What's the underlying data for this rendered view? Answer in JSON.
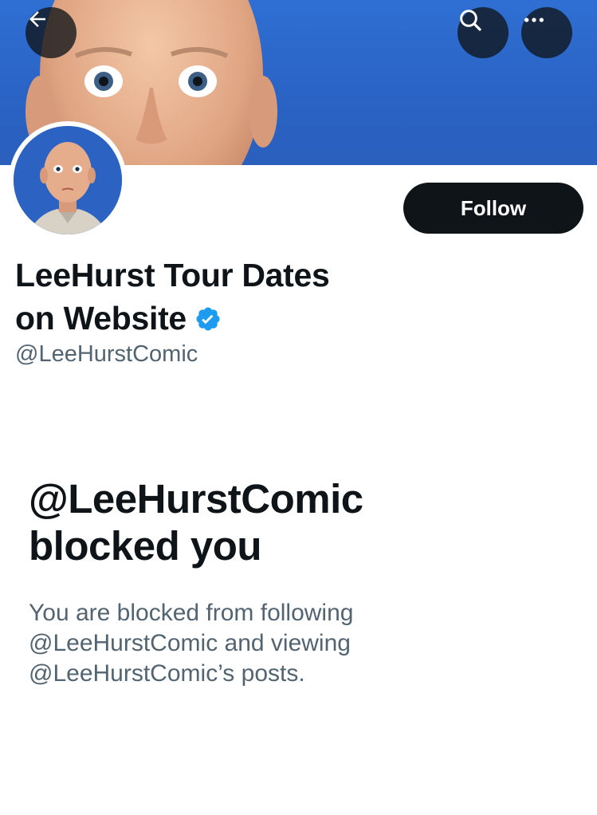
{
  "header": {
    "back_icon": "arrow-left-icon",
    "search_icon": "search-icon",
    "more_icon": "more-horizontal-icon"
  },
  "profile": {
    "display_name_line1": "LeeHurst Tour Dates",
    "display_name_line2": "on Website",
    "verified_icon": "verified-badge-icon",
    "handle": "@LeeHurstComic",
    "follow_label": "Follow"
  },
  "blocked": {
    "title_line1": "@LeeHurstComic",
    "title_line2": "blocked you",
    "description_line1": "You are blocked from following",
    "description_line2": "@LeeHurstComic and viewing",
    "description_line3": "@LeeHurstComic’s posts."
  },
  "colors": {
    "banner_blue": "#2f6fd3",
    "button_dark": "#0f1419",
    "verified_blue": "#1d9bf0",
    "secondary_text": "#536471"
  }
}
